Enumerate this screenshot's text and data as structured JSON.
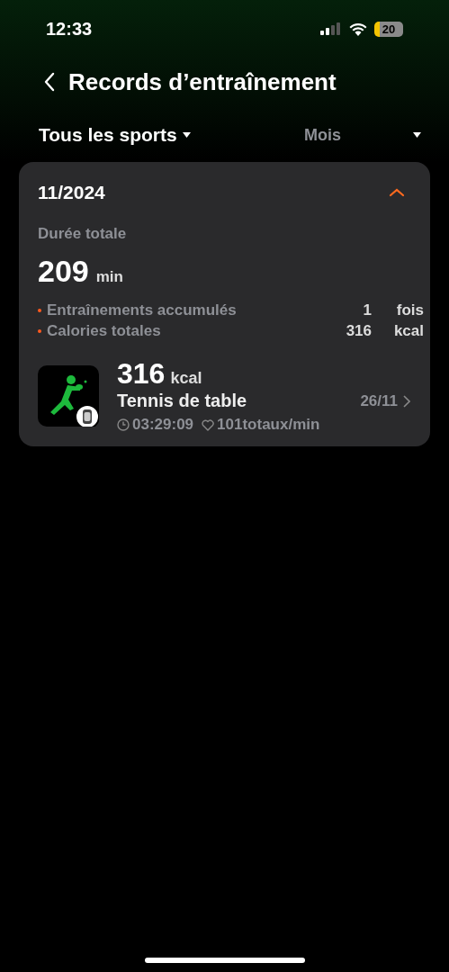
{
  "status_bar": {
    "time": "12:33",
    "battery": "20"
  },
  "header": {
    "title": "Records d’entraînement"
  },
  "filters": [
    {
      "label": "Tous les sports"
    },
    {
      "label": "Mois"
    }
  ],
  "month_card": {
    "month": "11/2024",
    "expanded": true,
    "duration_label": "Durée totale",
    "duration_value": "209",
    "duration_unit": "min",
    "stats": [
      {
        "label": "Entraînements accumulés",
        "value": "1",
        "unit": "fois"
      },
      {
        "label": "Calories totales",
        "value": "316",
        "unit": "kcal"
      }
    ],
    "workouts": [
      {
        "calories": "316",
        "calories_unit": "kcal",
        "sport": "Tennis de table",
        "date": "26/11",
        "duration": "03:29:09",
        "heart_rate": "101totaux/min"
      }
    ]
  }
}
